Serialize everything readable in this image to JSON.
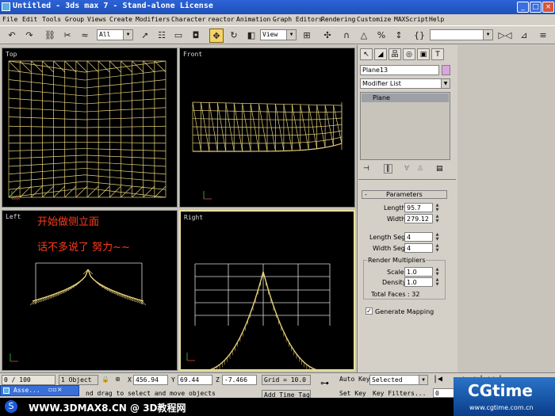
{
  "window": {
    "title": "Untitled - 3ds max 7 - Stand-alone License",
    "minimize": "_",
    "maximize": "□",
    "close": "×"
  },
  "menu": [
    "File",
    "Edit",
    "Tools",
    "Group",
    "Views",
    "Create",
    "Modifiers",
    "Character",
    "reactor",
    "Animation",
    "Graph Editors",
    "Rendering",
    "Customize",
    "MAXScript",
    "Help"
  ],
  "toolbar": {
    "selection_filter": "All",
    "reference_coord": "View",
    "named_selection": ""
  },
  "viewports": {
    "top": "Top",
    "front": "Front",
    "left": "Left",
    "right": "Right"
  },
  "annotations": {
    "line1": "开始做侧立面",
    "line2": "话不多说了   努力~~"
  },
  "command_panel": {
    "object_name": "Plane13",
    "object_color": "#d9a6e0",
    "modifier_list": "Modifier List",
    "stack_item": "Plane",
    "rollout_title": "Parameters",
    "length_label": "Length:",
    "length_value": "95.7",
    "width_label": "Width:",
    "width_value": "279.12",
    "length_segs_label": "Length Segs:",
    "length_segs_value": "4",
    "width_segs_label": "Width Segs:",
    "width_segs_value": "4",
    "render_multipliers": "Render Multipliers",
    "scale_label": "Scale:",
    "scale_value": "1.0",
    "density_label": "Density:",
    "density_value": "1.0",
    "total_faces": "Total Faces : 32",
    "generate_mapping": "Generate Mapping",
    "generate_mapping_checked": true
  },
  "status": {
    "time_slider": "0 / 100",
    "selection": "1 Object",
    "prompt": "nd drag to select and move objects",
    "x_label": "X",
    "x_value": "456.94",
    "y_label": "Y",
    "y_value": "69.44",
    "z_label": "Z",
    "z_value": "-7.466",
    "grid": "Grid = 10.0",
    "add_time_tag": "Add Time Tag",
    "auto_key": "Auto Key",
    "set_key": "Set Key",
    "selected_combo": "Selected",
    "key_filters": "Key Filters...",
    "frame": "0"
  },
  "taskbar": {
    "task": "Asse...",
    "watermark": "WWW.3DMAX8.CN @ 3D教程网",
    "cgtime": "CGtime",
    "cgtime_url": "www.cgtime.com.cn"
  },
  "colors": {
    "wire": "#e8d27a",
    "title_blue": "#2558c8",
    "annotation_red": "#ff3a1a"
  }
}
